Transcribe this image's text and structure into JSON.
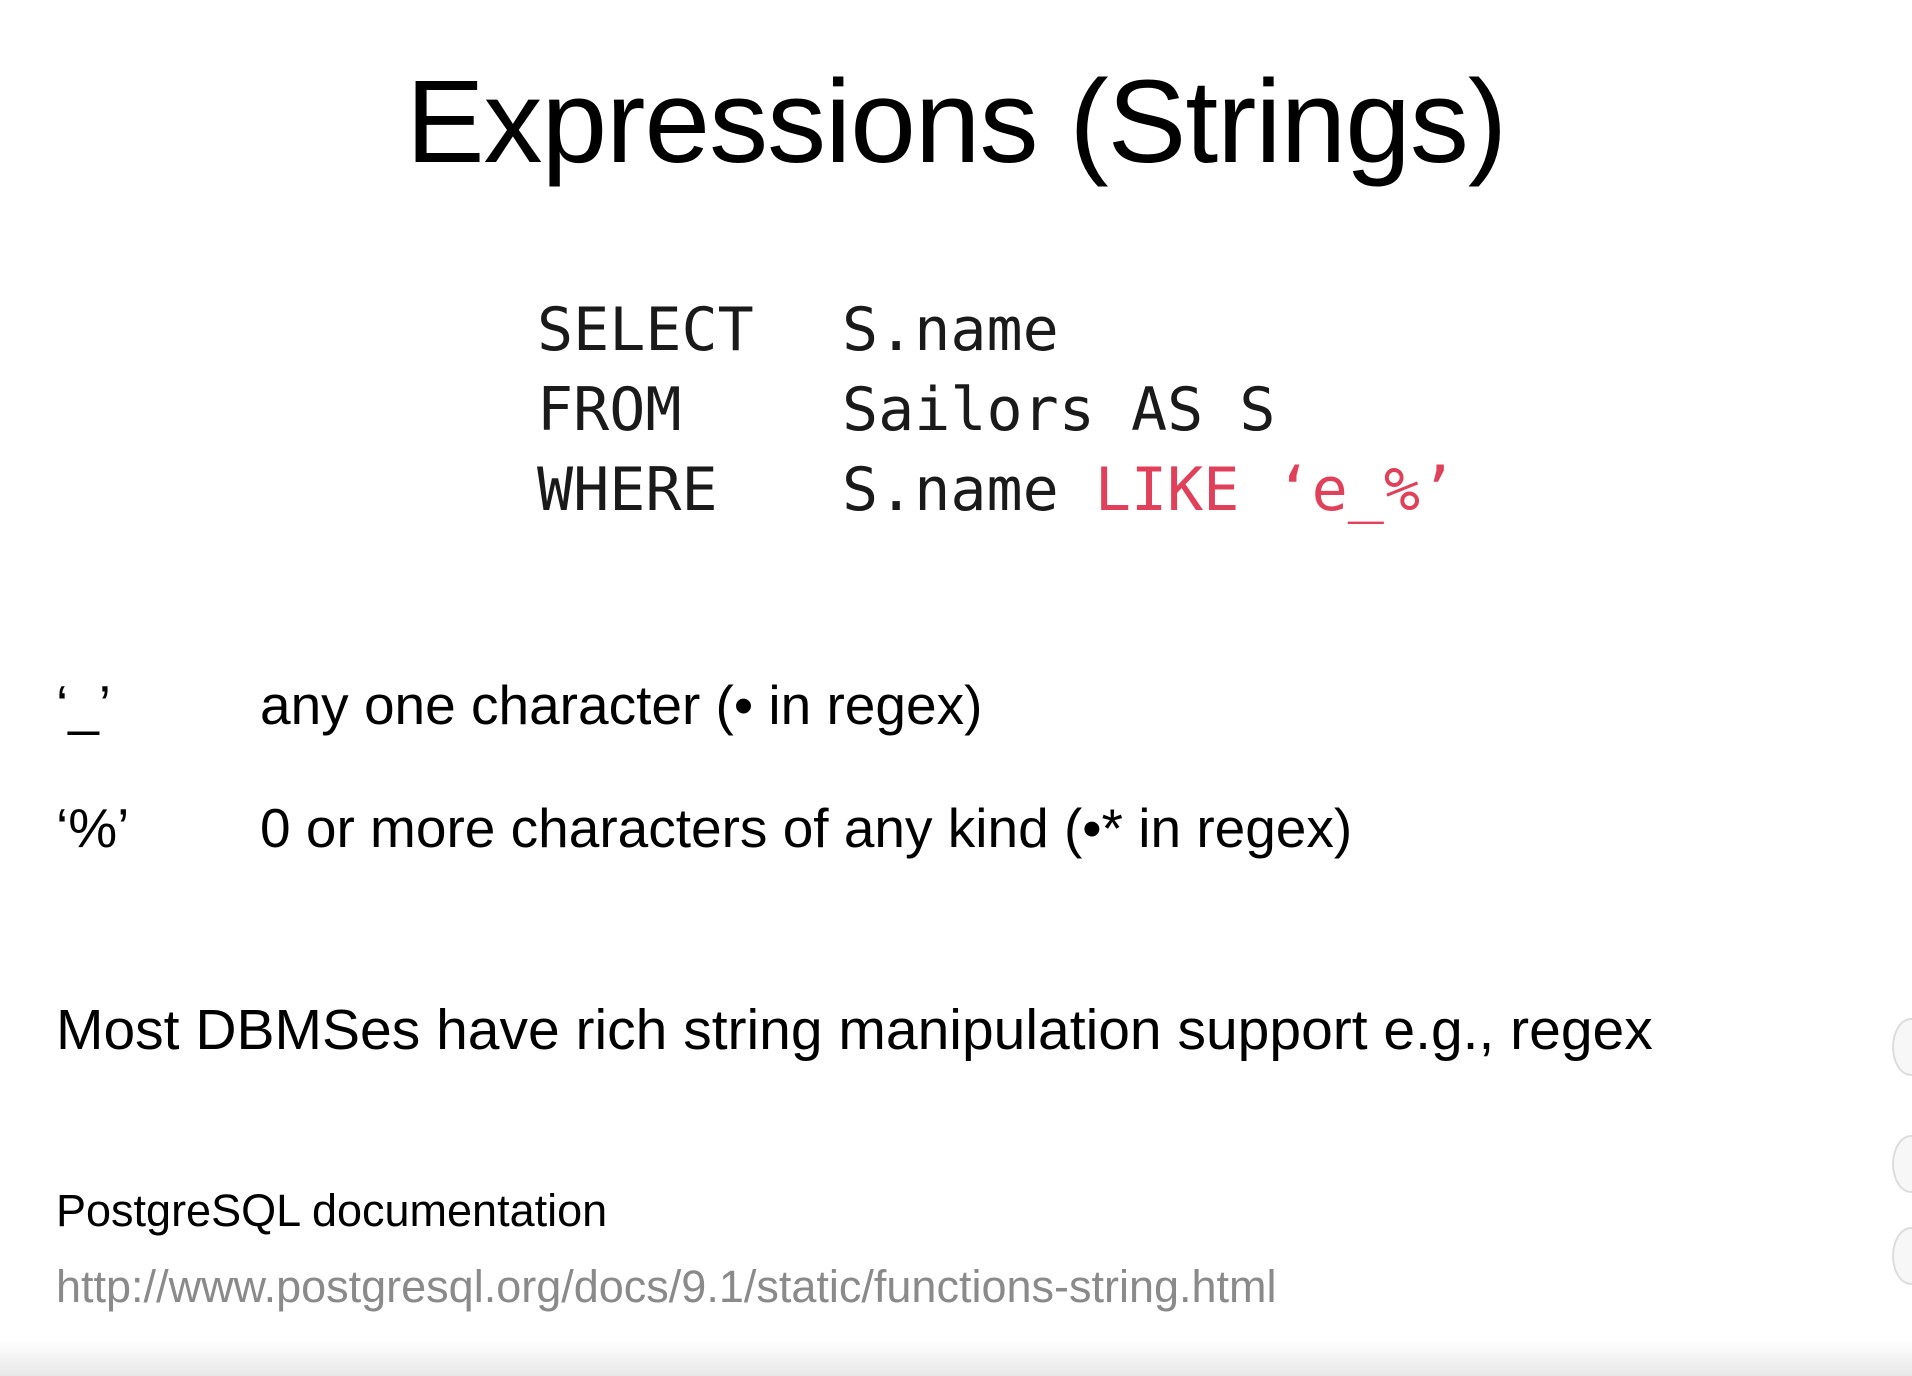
{
  "slide": {
    "title": "Expressions (Strings)",
    "query": [
      {
        "keyword": "SELECT",
        "plain": "S.name",
        "highlight": ""
      },
      {
        "keyword": "FROM",
        "plain": "Sailors AS S",
        "highlight": ""
      },
      {
        "keyword": "WHERE",
        "plain": "S.name ",
        "highlight": "LIKE ‘e_%’"
      }
    ],
    "wildcards": [
      {
        "symbol": "‘_’",
        "description": "any one character (• in regex)"
      },
      {
        "symbol": "‘%’",
        "description": "0 or more characters of any kind (•* in regex)"
      }
    ],
    "note": "Most DBMSes have rich string manipulation support e.g., regex",
    "reference_label": "PostgreSQL documentation",
    "reference_url": "http://www.postgresql.org/docs/9.1/static/functions-string.html"
  },
  "colors": {
    "highlight": "#e0405a",
    "url": "#8a8a8a"
  }
}
